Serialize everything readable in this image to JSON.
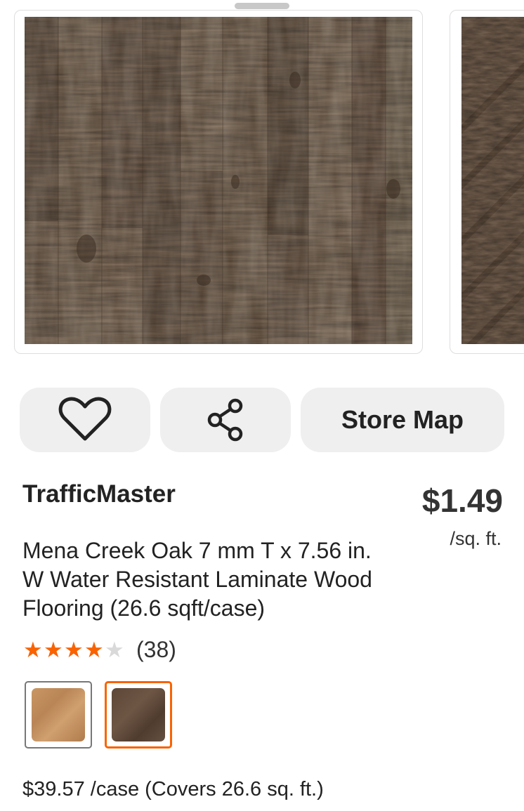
{
  "product": {
    "brand": "TrafficMaster",
    "title": "Mena Creek Oak 7 mm T x 7.56 in. W Water Resistant Laminate Wood Flooring (26.6 sqft/case)",
    "price": "$1.49",
    "price_unit": "/sq. ft.",
    "rating_value": 4,
    "rating_max": 5,
    "review_count": "(38)",
    "case_price": "$39.57 /case (Covers 26.6 sq. ft.)"
  },
  "actions": {
    "favorite_icon": "heart-icon",
    "share_icon": "share-icon",
    "store_map_label": "Store Map"
  },
  "swatches": [
    {
      "name": "light-oak",
      "selected": false,
      "color": "#c99663"
    },
    {
      "name": "mena-creek-oak",
      "selected": true,
      "color": "#5c4636"
    }
  ],
  "colors": {
    "accent": "#f96302",
    "button_bg": "#efefef",
    "star_off": "#d9d9d9"
  }
}
